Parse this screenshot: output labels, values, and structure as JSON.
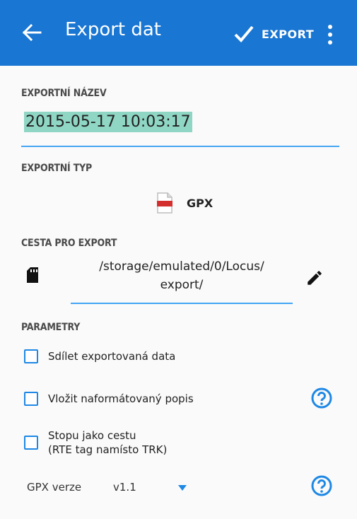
{
  "appbar": {
    "title": "Export dat",
    "action_label": "EXPORT",
    "color": "#1976d2"
  },
  "export_name": {
    "label": "EXPORTNÍ NÁZEV",
    "value": "2015-05-17 10:03:17"
  },
  "export_type": {
    "label": "EXPORTNÍ TYP",
    "value": "GPX",
    "icon": "gpx-file-icon"
  },
  "export_path": {
    "label": "CESTA PRO EXPORT",
    "line1": "/storage/emulated/0/Locus/",
    "line2": "export/",
    "icon": "sd-card-icon",
    "edit_icon": "pencil-icon"
  },
  "params": {
    "label": "PARAMETRY",
    "share": {
      "label": "Sdílet exportovaná data",
      "checked": false
    },
    "formatted": {
      "label": "Vložit naformátovaný popis",
      "checked": false
    },
    "route_line1": "Stopu jako cestu",
    "route_line2": "(RTE tag namísto TRK)",
    "route_checked": false,
    "gpx_version_label": "GPX verze",
    "gpx_version_value": "v1.1"
  },
  "accent": "#1e88e5",
  "selection_color": "#8fd6c4"
}
